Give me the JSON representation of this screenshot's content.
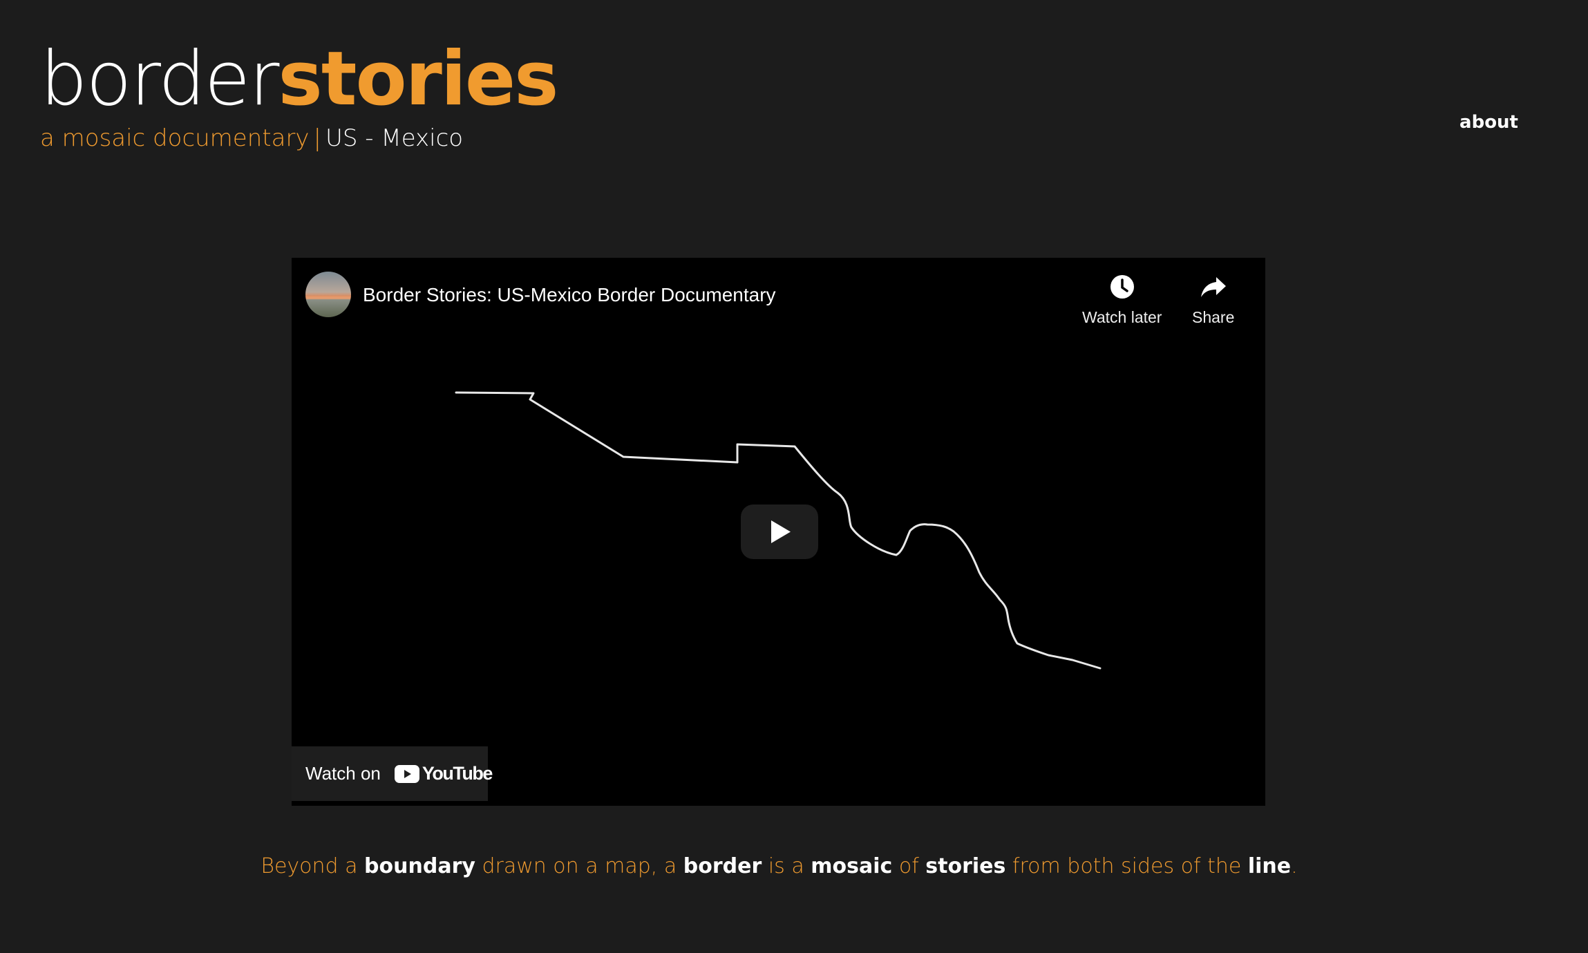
{
  "logo": {
    "part1": "border",
    "part2": "stories"
  },
  "tagline": {
    "part1": "a mosaic documentary",
    "separator": "|",
    "part2": "US - Mexico"
  },
  "nav": {
    "about": "about"
  },
  "video": {
    "title": "Border Stories: US-Mexico Border Documentary",
    "controls": {
      "watch_later": "Watch later",
      "share": "Share"
    },
    "watch_on": {
      "text": "Watch on",
      "brand": "YouTube"
    },
    "icons": {
      "watch_later": "clock-icon",
      "share": "share-arrow-icon",
      "play": "play-icon",
      "brand": "youtube-logo-icon"
    }
  },
  "caption": [
    {
      "text": "Beyond a ",
      "emphasis": false
    },
    {
      "text": "boundary",
      "emphasis": true
    },
    {
      "text": " drawn on a map, a ",
      "emphasis": false
    },
    {
      "text": "border",
      "emphasis": true
    },
    {
      "text": " is a ",
      "emphasis": false
    },
    {
      "text": "mosaic",
      "emphasis": true
    },
    {
      "text": " of ",
      "emphasis": false
    },
    {
      "text": "stories",
      "emphasis": true
    },
    {
      "text": " from both sides of the ",
      "emphasis": false
    },
    {
      "text": "line",
      "emphasis": true
    },
    {
      "text": ".",
      "emphasis": false
    }
  ],
  "colors": {
    "background": "#1c1c1c",
    "accent": "#f09b2f",
    "text": "#ffffff",
    "video_background": "#000000"
  }
}
